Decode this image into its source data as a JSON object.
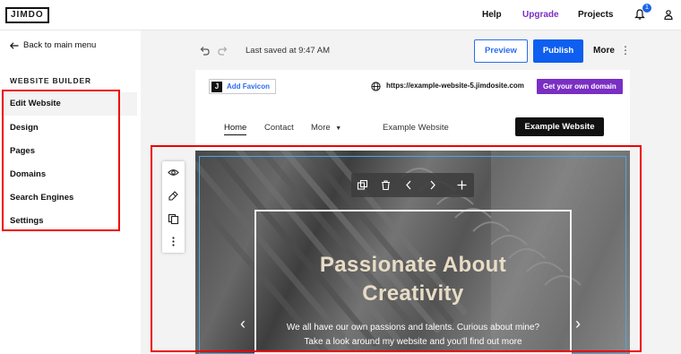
{
  "topbar": {
    "logo": "JIMDO",
    "help": "Help",
    "upgrade": "Upgrade",
    "projects": "Projects",
    "notification_count": "1",
    "upgrade_color": "#7a2ec4"
  },
  "sidebar": {
    "back": "Back to main menu",
    "section_title": "WEBSITE BUILDER",
    "items": [
      {
        "label": "Edit Website"
      },
      {
        "label": "Design"
      },
      {
        "label": "Pages"
      },
      {
        "label": "Domains"
      },
      {
        "label": "Search Engines"
      },
      {
        "label": "Settings"
      }
    ]
  },
  "toolbar": {
    "saved": "Last saved at 9:47 AM",
    "preview": "Preview",
    "publish": "Publish",
    "more": "More",
    "accent": "#0e5ef0"
  },
  "site": {
    "favicon_label": "Add Favicon",
    "favicon_letter": "J",
    "url": "https://example-website-5.jimdosite.com",
    "domain_button": "Get your own domain",
    "nav": {
      "home": "Home",
      "contact": "Contact",
      "more": "More",
      "title": "Example Website",
      "cta": "Example Website"
    },
    "hero": {
      "title_line1": "Passionate About",
      "title_line2": "Creativity",
      "text": "We all have our own passions and talents. Curious about mine? Take a look around my website and you'll find out more"
    }
  }
}
